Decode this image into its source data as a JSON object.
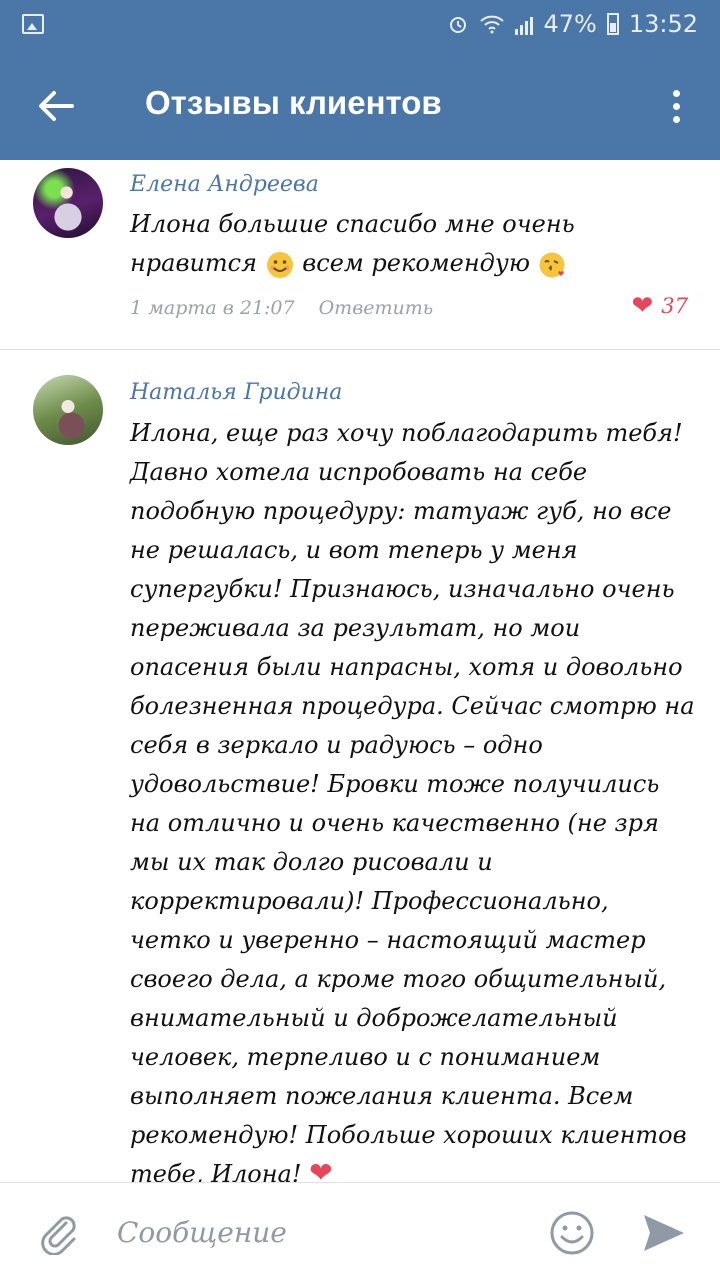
{
  "status_bar": {
    "battery": "47%",
    "time": "13:52",
    "icons": [
      "image-icon",
      "alarm-icon",
      "wifi-icon",
      "signal-icon",
      "battery-icon"
    ]
  },
  "header": {
    "title": "Отзывы клиентов",
    "back_icon": "arrow-left-icon",
    "menu_icon": "more-vertical-icon"
  },
  "comments": [
    {
      "author": "Елена Андреева",
      "text_before_emoji": "Илона большие спасибо мне очень нравится",
      "text_after_emoji": "всем рекомендую",
      "date": "1 марта в 21:07",
      "reply_label": "Ответить",
      "likes": "37"
    },
    {
      "author": "Наталья Гридина",
      "text": "Илона, еще раз хочу поблагодарить тебя! Давно хотела испробовать на себе подобную процедуру: татуаж губ, но все не решалась, и вот теперь у меня супергубки! Признаюсь, изначально очень переживала за результат, но мои опасения были напрасны, хотя и довольно болезненная процедура. Сейчас смотрю на себя в зеркало и радуюсь – одно удовольствие! Бровки тоже получились на отлично и очень качественно (не зря мы их так долго рисовали и корректировали)! Профессионально, четко и уверенно – настоящий мастер своего дела, а кроме того общительный, внимательный и доброжелательный человек, терпеливо и с пониманием выполняет пожелания клиента. Всем рекомендую! Побольше хороших клиентов тебе, Илона!"
    }
  ],
  "composer": {
    "placeholder": "Сообщение",
    "icons": [
      "paperclip-icon",
      "smile-icon",
      "send-icon"
    ]
  },
  "colors": {
    "brand": "#4a76a8",
    "author": "#4a76a8",
    "like": "#e6455a",
    "meta": "#9aa3ab"
  }
}
